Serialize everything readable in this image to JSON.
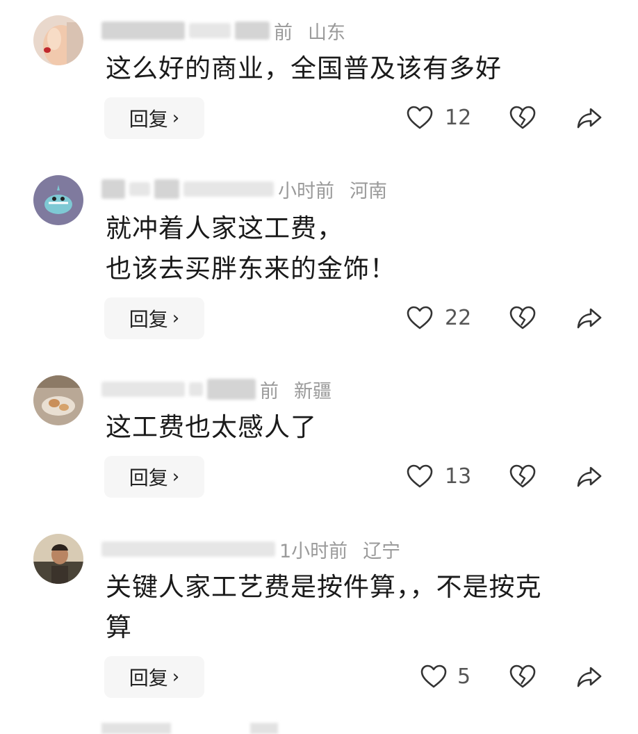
{
  "reply_label": "回复",
  "comments": [
    {
      "time": "前",
      "location": "山东",
      "lines": [
        "这么好的商业，全国普及该有多好"
      ],
      "likes": "12"
    },
    {
      "time": "小时前",
      "location": "河南",
      "lines": [
        "就冲着人家这工费，",
        "也该去买胖东来的金饰！"
      ],
      "likes": "22"
    },
    {
      "time": "前",
      "location": "新疆",
      "lines": [
        "这工费也太感人了"
      ],
      "likes": "13"
    },
    {
      "time": "1小时前",
      "location": "辽宁",
      "lines": [
        "关键人家工艺费是按件算，，不是按克",
        "算"
      ],
      "likes": "5"
    }
  ],
  "icons": {
    "like": "heart-outline-icon",
    "dislike": "broken-heart-icon",
    "share": "share-arrow-icon"
  }
}
